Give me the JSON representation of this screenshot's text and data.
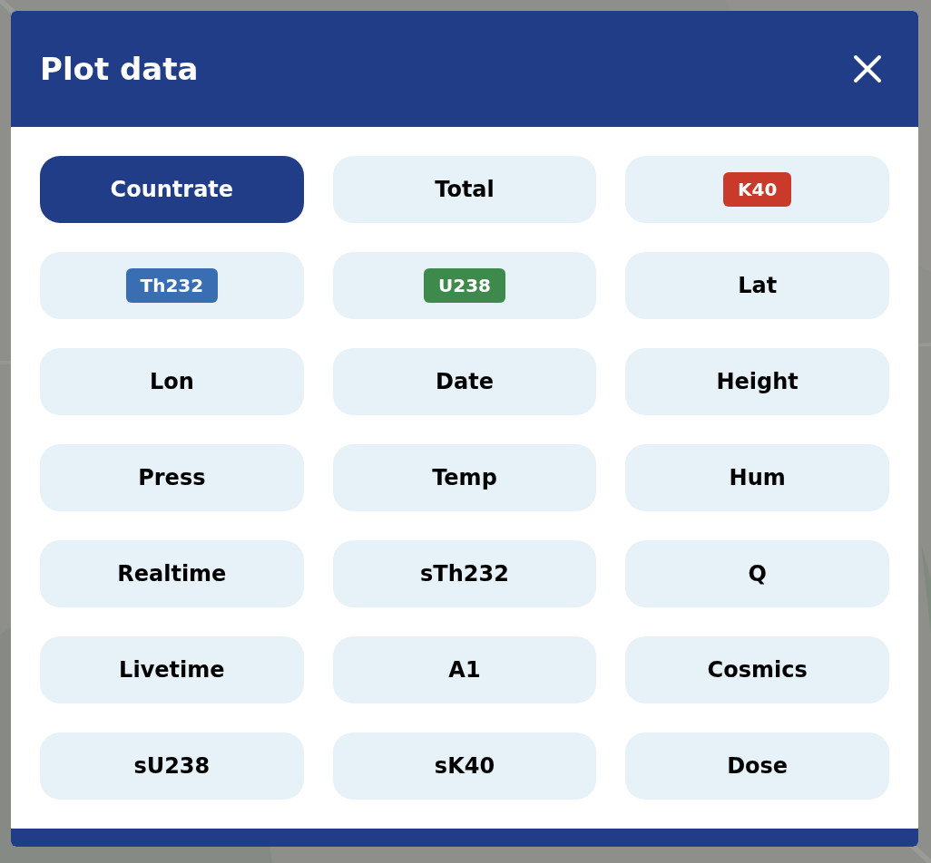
{
  "dialog": {
    "title": "Plot data"
  },
  "options": [
    {
      "label": "Countrate",
      "selected": true,
      "kind": "plain"
    },
    {
      "label": "Total",
      "selected": false,
      "kind": "plain"
    },
    {
      "label": "K40",
      "selected": false,
      "kind": "badge",
      "color": "#c93a2b"
    },
    {
      "label": "Th232",
      "selected": false,
      "kind": "badge",
      "color": "#3a6eb3"
    },
    {
      "label": "U238",
      "selected": false,
      "kind": "badge",
      "color": "#3d8a4c"
    },
    {
      "label": "Lat",
      "selected": false,
      "kind": "plain"
    },
    {
      "label": "Lon",
      "selected": false,
      "kind": "plain"
    },
    {
      "label": "Date",
      "selected": false,
      "kind": "plain"
    },
    {
      "label": "Height",
      "selected": false,
      "kind": "plain"
    },
    {
      "label": "Press",
      "selected": false,
      "kind": "plain"
    },
    {
      "label": "Temp",
      "selected": false,
      "kind": "plain"
    },
    {
      "label": "Hum",
      "selected": false,
      "kind": "plain"
    },
    {
      "label": "Realtime",
      "selected": false,
      "kind": "plain"
    },
    {
      "label": "sTh232",
      "selected": false,
      "kind": "plain"
    },
    {
      "label": "Q",
      "selected": false,
      "kind": "plain"
    },
    {
      "label": "Livetime",
      "selected": false,
      "kind": "plain"
    },
    {
      "label": "A1",
      "selected": false,
      "kind": "plain"
    },
    {
      "label": "Cosmics",
      "selected": false,
      "kind": "plain"
    },
    {
      "label": "sU238",
      "selected": false,
      "kind": "plain"
    },
    {
      "label": "sK40",
      "selected": false,
      "kind": "plain"
    },
    {
      "label": "Dose",
      "selected": false,
      "kind": "plain"
    }
  ]
}
